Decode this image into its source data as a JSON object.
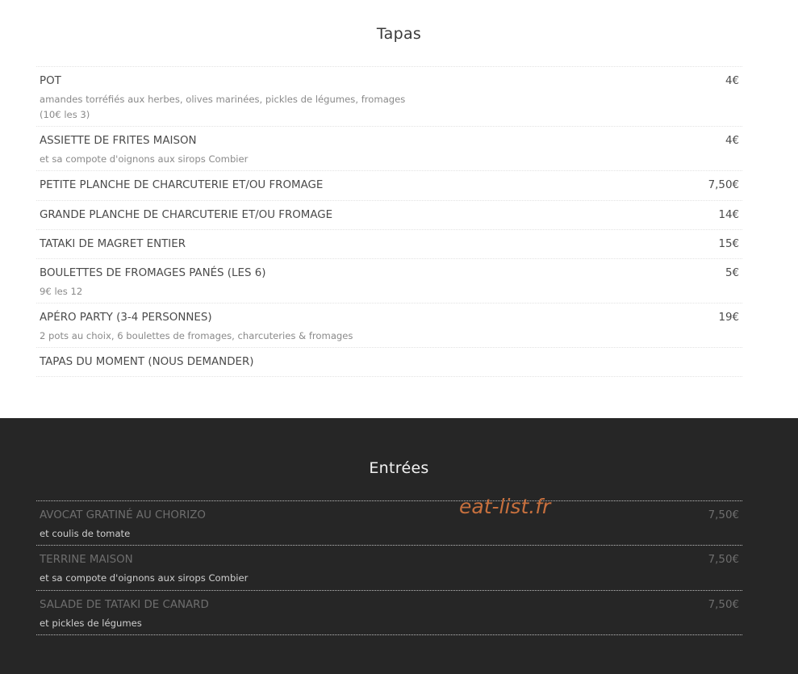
{
  "tapas": {
    "title": "Tapas",
    "items": [
      {
        "name": "POT",
        "price": "4€",
        "description": "amandes torréfiés aux herbes, olives marinées, pickles de légumes, fromages",
        "description2": "(10€ les 3)"
      },
      {
        "name": "ASSIETTE DE FRITES MAISON",
        "price": "4€",
        "description": "et sa compote d'oignons aux sirops Combier"
      },
      {
        "name": "PETITE PLANCHE DE CHARCUTERIE ET/OU FROMAGE",
        "price": "7,50€"
      },
      {
        "name": "GRANDE PLANCHE DE CHARCUTERIE ET/OU FROMAGE",
        "price": "14€"
      },
      {
        "name": "TATAKI DE MAGRET ENTIER",
        "price": "15€"
      },
      {
        "name": "BOULETTES DE FROMAGES PANÉS (LES 6)",
        "price": "5€",
        "description": "9€ les 12"
      },
      {
        "name": "APÉRO PARTY (3-4 PERSONNES)",
        "price": "19€",
        "description": "2 pots au choix, 6 boulettes de fromages, charcuteries & fromages"
      },
      {
        "name": "TAPAS DU MOMENT (NOUS DEMANDER)"
      }
    ]
  },
  "entrees": {
    "title": "Entrées",
    "items": [
      {
        "name": "AVOCAT GRATINÉ AU CHORIZO",
        "price": "7,50€",
        "description": "et coulis de tomate"
      },
      {
        "name": "TERRINE MAISON",
        "price": "7,50€",
        "description": "et sa compote d'oignons aux sirops Combier"
      },
      {
        "name": "SALADE DE TATAKI DE CANARD",
        "price": "7,50€",
        "description": "et pickles de légumes"
      }
    ]
  },
  "watermark": "eat-list.fr",
  "colors": {
    "dark_background": "#262626",
    "watermark": "#c7703e"
  }
}
